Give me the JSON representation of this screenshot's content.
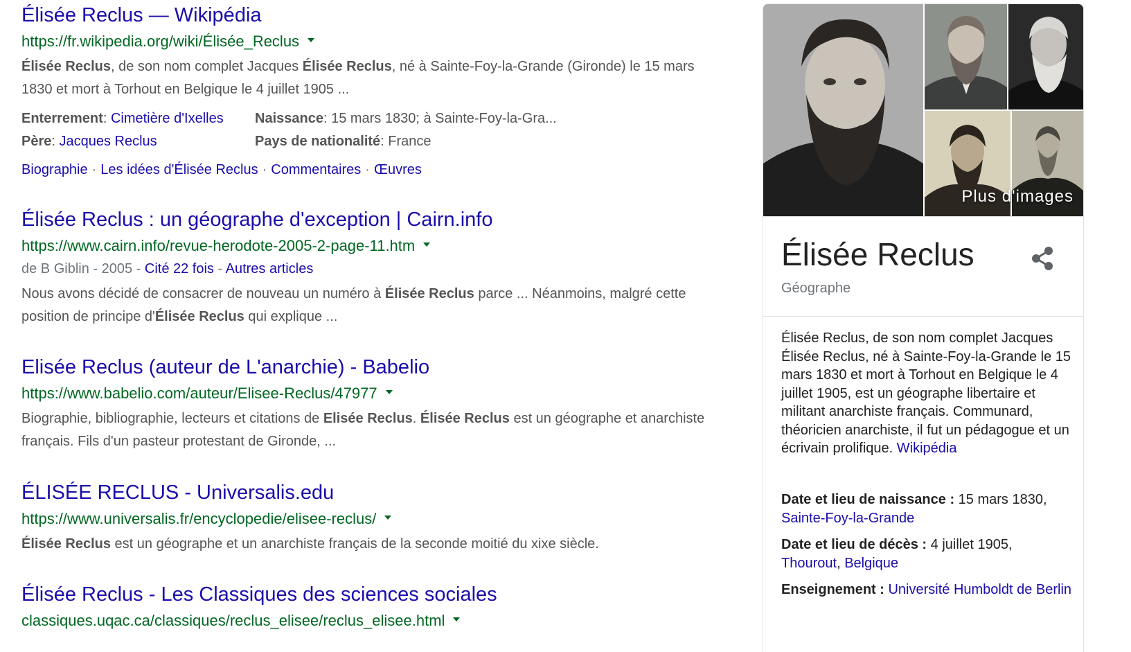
{
  "results": [
    {
      "title": "Élisée Reclus — Wikipédia",
      "url": "https://fr.wikipedia.org/wiki/Élisée_Reclus",
      "snippet": [
        {
          "t": "Élisée Reclus",
          "b": true
        },
        {
          "t": ", de son nom complet Jacques ",
          "b": false
        },
        {
          "t": "Élisée Reclus",
          "b": true
        },
        {
          "t": ", né à Sainte-Foy-la-Grande (Gironde) le 15 mars 1830 et mort à Torhout en Belgique le 4 juillet 1905 ...",
          "b": false
        }
      ],
      "facts": [
        {
          "key": "Enterrement",
          "value": "Cimetière d'Ixelles",
          "link": true
        },
        {
          "key": "Naissance",
          "value": "15 mars 1830; à Sainte-Foy-la-Gra...",
          "link": false
        },
        {
          "key": "Père",
          "value": "Jacques Reclus",
          "link": true
        },
        {
          "key": "Pays de nationalité",
          "value": "France",
          "link": false
        }
      ],
      "sitelinks": [
        "Biographie",
        "Les idées d'Élisée Reclus",
        "Commentaires",
        "Œuvres"
      ]
    },
    {
      "title": "Élisée Reclus : un géographe d'exception | Cairn.info",
      "url": "https://www.cairn.info/revue-herodote-2005-2-page-11.htm",
      "meta_prefix": "de B Giblin - 2005 - ",
      "meta_cited": "Cité 22 fois",
      "meta_sep": " - ",
      "meta_other": "Autres articles",
      "snippet": [
        {
          "t": "Nous avons décidé de consacrer de nouveau un numéro à ",
          "b": false
        },
        {
          "t": "Élisée Reclus",
          "b": true
        },
        {
          "t": " parce ... Néanmoins, malgré cette position de principe d'",
          "b": false
        },
        {
          "t": "Élisée Reclus",
          "b": true
        },
        {
          "t": " qui explique ...",
          "b": false
        }
      ]
    },
    {
      "title": "Elisée Reclus (auteur de L'anarchie) - Babelio",
      "url": "https://www.babelio.com/auteur/Elisee-Reclus/47977",
      "snippet": [
        {
          "t": "Biographie, bibliographie, lecteurs et citations de ",
          "b": false
        },
        {
          "t": "Elisée Reclus",
          "b": true
        },
        {
          "t": ". ",
          "b": false
        },
        {
          "t": "Élisée Reclus",
          "b": true
        },
        {
          "t": " est un géographe et anarchiste français. Fils d'un pasteur protestant de Gironde, ...",
          "b": false
        }
      ]
    },
    {
      "title": "ÉLISÉE RECLUS - Universalis.edu",
      "url": "https://www.universalis.fr/encyclopedie/elisee-reclus/",
      "snippet": [
        {
          "t": "Élisée Reclus",
          "b": true
        },
        {
          "t": " est un géographe et un anarchiste français de la seconde moitié du xixe siècle.",
          "b": false
        }
      ]
    },
    {
      "title": "Élisée Reclus - Les Classiques des sciences sociales",
      "url": "classiques.uqac.ca/classiques/reclus_elisee/reclus_elisee.html"
    }
  ],
  "knowledge_panel": {
    "more_images": "Plus d'images",
    "name": "Élisée Reclus",
    "subtitle": "Géographe",
    "description": "Élisée Reclus, de son nom complet Jacques Élisée Reclus, né à Sainte-Foy-la-Grande le 15 mars 1830 et mort à Torhout en Belgique le 4 juillet 1905, est un géographe libertaire et militant anarchiste français. Communard, théoricien anarchiste, il fut un pédagogue et un écrivain prolifique.",
    "source": "Wikipédia",
    "facts": [
      {
        "key": "Date et lieu de naissance :",
        "parts": [
          {
            "t": " 15 mars 1830, ",
            "l": false
          },
          {
            "t": "Sainte-Foy-la-Grande",
            "l": true
          }
        ]
      },
      {
        "key": "Date et lieu de décès :",
        "parts": [
          {
            "t": " 4 juillet 1905, ",
            "l": false
          },
          {
            "t": "Thourout",
            "l": true
          },
          {
            "t": ", ",
            "l": false
          },
          {
            "t": "Belgique",
            "l": true
          }
        ]
      },
      {
        "key": "Enseignement :",
        "parts": [
          {
            "t": " ",
            "l": false
          },
          {
            "t": "Université Humboldt de Berlin",
            "l": true
          }
        ]
      }
    ]
  },
  "colors": {
    "link": "#1a0dab",
    "url": "#006621",
    "snippet": "#545454",
    "muted": "#70757a"
  },
  "icons": [
    "dropdown-caret-icon",
    "share-icon"
  ]
}
